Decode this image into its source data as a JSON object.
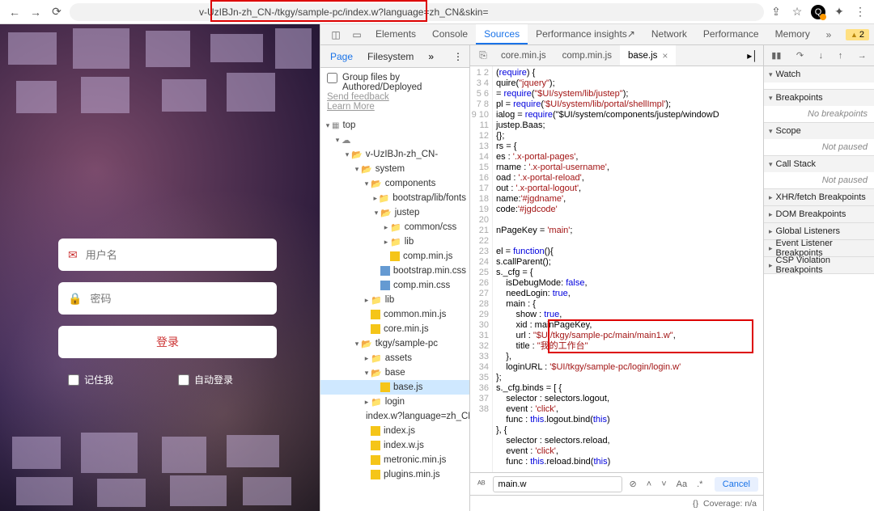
{
  "browser": {
    "url_visible": "v-UzIBJn-zh_CN-/tkgy/sample-pc/index.w?language=zh_CN&skin=",
    "url_highlight_segment": "-/tkgy/sample-pc/index.w?"
  },
  "login": {
    "username_placeholder": "用户名",
    "password_placeholder": "密码",
    "submit_label": "登录",
    "remember_label": "记住我",
    "autologin_label": "自动登录"
  },
  "devtools": {
    "tabs": [
      "Elements",
      "Console",
      "Sources",
      "Performance insights",
      "Network",
      "Performance",
      "Memory"
    ],
    "active_tab": "Sources",
    "warning_count": "2",
    "navigator": {
      "tabs": [
        "Page",
        "Filesystem"
      ],
      "active": "Page",
      "group_label": "Group files by Authored/Deployed",
      "feedback_link": "Send feedback",
      "learnmore_link": "Learn More",
      "tree": [
        {
          "depth": 0,
          "kind": "page",
          "label": "top",
          "tw": "▾"
        },
        {
          "depth": 1,
          "kind": "cloud",
          "label": "",
          "tw": "▾"
        },
        {
          "depth": 2,
          "kind": "folder-open",
          "label": "v-UzIBJn-zh_CN-",
          "tw": "▾"
        },
        {
          "depth": 3,
          "kind": "folder-open",
          "label": "system",
          "tw": "▾"
        },
        {
          "depth": 4,
          "kind": "folder-open",
          "label": "components",
          "tw": "▾"
        },
        {
          "depth": 5,
          "kind": "folder-closed",
          "label": "bootstrap/lib/fonts",
          "tw": "▸"
        },
        {
          "depth": 5,
          "kind": "folder-open",
          "label": "justep",
          "tw": "▾"
        },
        {
          "depth": 6,
          "kind": "folder-closed",
          "label": "common/css",
          "tw": "▸"
        },
        {
          "depth": 6,
          "kind": "folder-closed",
          "label": "lib",
          "tw": "▸"
        },
        {
          "depth": 6,
          "kind": "js",
          "label": "comp.min.js",
          "tw": ""
        },
        {
          "depth": 5,
          "kind": "css",
          "label": "bootstrap.min.css",
          "tw": ""
        },
        {
          "depth": 5,
          "kind": "css",
          "label": "comp.min.css",
          "tw": ""
        },
        {
          "depth": 4,
          "kind": "folder-closed",
          "label": "lib",
          "tw": "▸"
        },
        {
          "depth": 4,
          "kind": "js",
          "label": "common.min.js",
          "tw": ""
        },
        {
          "depth": 4,
          "kind": "js",
          "label": "core.min.js",
          "tw": ""
        },
        {
          "depth": 3,
          "kind": "folder-open",
          "label": "tkgy/sample-pc",
          "tw": "▾"
        },
        {
          "depth": 4,
          "kind": "folder-closed",
          "label": "assets",
          "tw": "▸"
        },
        {
          "depth": 4,
          "kind": "folder-open",
          "label": "base",
          "tw": "▾"
        },
        {
          "depth": 5,
          "kind": "js",
          "label": "base.js",
          "tw": "",
          "selected": true
        },
        {
          "depth": 4,
          "kind": "folder-closed",
          "label": "login",
          "tw": "▸"
        },
        {
          "depth": 4,
          "kind": "js",
          "label": "index.w?language=zh_CN",
          "tw": ""
        },
        {
          "depth": 4,
          "kind": "js",
          "label": "index.js",
          "tw": ""
        },
        {
          "depth": 4,
          "kind": "js",
          "label": "index.w.js",
          "tw": ""
        },
        {
          "depth": 4,
          "kind": "js",
          "label": "metronic.min.js",
          "tw": ""
        },
        {
          "depth": 4,
          "kind": "js",
          "label": "plugins.min.js",
          "tw": ""
        }
      ]
    },
    "open_files": [
      "core.min.js",
      "comp.min.js",
      "base.js"
    ],
    "active_file": "base.js",
    "code": [
      "(require) {",
      "quire(\"jquery\");",
      "= require(\"$UI/system/lib/justep\");",
      "pl = require('$UI/system/lib/portal/shellImpl');",
      "ialog = require(\"$UI/system/components/justep/windowD",
      "justep.Baas;",
      "{};",
      "rs = {",
      "es : '.x-portal-pages',",
      "rname : '.x-portal-username',",
      "oad : '.x-portal-reload',",
      "out : '.x-portal-logout',",
      "name:'#jgdname',",
      "code:'#jgdcode'",
      "",
      "nPageKey = 'main';",
      "",
      "el = function(){",
      "s.callParent();",
      "s._cfg = {",
      "    isDebugMode: false,",
      "    needLogin: true,",
      "    main : {",
      "        show : true,",
      "        xid : mainPageKey,",
      "        url : \"$UI/tkgy/sample-pc/main/main1.w\",",
      "        title : \"我的工作台\"",
      "    },",
      "    loginURL : '$UI/tkgy/sample-pc/login/login.w'",
      "};",
      "s._cfg.binds = [ {",
      "    selector : selectors.logout,",
      "    event : 'click',",
      "    func : this.logout.bind(this)",
      "}, {",
      "    selector : selectors.reload,",
      "    event : 'click',",
      "    func : this.reload.bind(this)"
    ],
    "first_line_number": 1,
    "search": {
      "value": "main.w",
      "cancel_label": "Cancel",
      "aa": "Aa",
      "regex": ".*"
    },
    "coverage_label": "Coverage: n/a",
    "debugger": {
      "sections": [
        {
          "label": "Watch",
          "open": true,
          "body": ""
        },
        {
          "label": "Breakpoints",
          "open": true,
          "body": "No breakpoints"
        },
        {
          "label": "Scope",
          "open": true,
          "body": "Not paused"
        },
        {
          "label": "Call Stack",
          "open": true,
          "body": "Not paused"
        },
        {
          "label": "XHR/fetch Breakpoints",
          "open": false
        },
        {
          "label": "DOM Breakpoints",
          "open": false
        },
        {
          "label": "Global Listeners",
          "open": false
        },
        {
          "label": "Event Listener Breakpoints",
          "open": false
        },
        {
          "label": "CSP Violation Breakpoints",
          "open": false
        }
      ]
    }
  }
}
